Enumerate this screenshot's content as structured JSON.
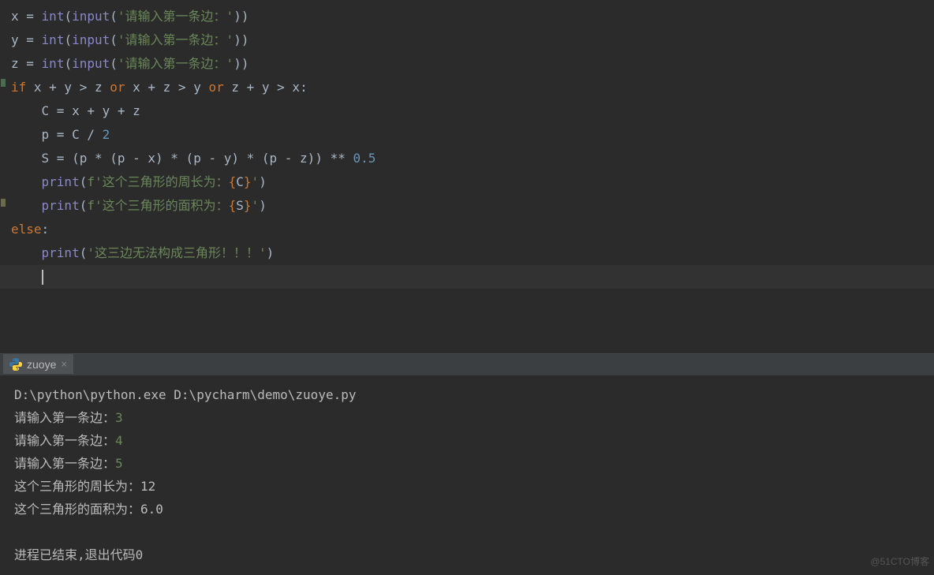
{
  "code": {
    "l1_var": "x",
    "l1_eq": " = ",
    "l1_int": "int",
    "l1_p1": "(",
    "l1_input": "input",
    "l1_p2": "(",
    "l1_str": "'请输入第一条边：'",
    "l1_p3": "))",
    "l2_var": "y",
    "l3_var": "z",
    "if_kw": "if",
    "if_cond_a": " x + y > z ",
    "or_kw": "or",
    "if_cond_b": " x + z > y ",
    "if_cond_c": " z + y > x:",
    "c_line": "    C = x + y + z",
    "p_prefix": "    p = C / ",
    "p_num": "2",
    "s_prefix": "    S = (p * (p - x) * (p - y) * (p - z)) ** ",
    "s_num": "0.5",
    "print_fn": "print",
    "indent": "    ",
    "fstr_open": "f'",
    "fstr1_txt": "这个三角形的周长为：",
    "fstr1_var": "C",
    "fstr2_txt": "这个三角形的面积为：",
    "fstr2_var": "S",
    "brace_o": "{",
    "brace_c": "}",
    "fstr_close": "'",
    "pp": "(",
    "pc": ")",
    "else_kw": "else",
    "colon": ":",
    "err_str": "'这三边无法构成三角形！！！'"
  },
  "tab": {
    "name": "zuoye"
  },
  "console": {
    "cmd": "D:\\python\\python.exe D:\\pycharm\\demo\\zuoye.py",
    "p1": "请输入第一条边：",
    "i1": "3",
    "p2": "请输入第一条边：",
    "i2": "4",
    "p3": "请输入第一条边：",
    "i3": "5",
    "r1": "这个三角形的周长为：12",
    "r2": "这个三角形的面积为：6.0",
    "exit": "进程已结束,退出代码0"
  },
  "watermark": "@51CTO博客"
}
